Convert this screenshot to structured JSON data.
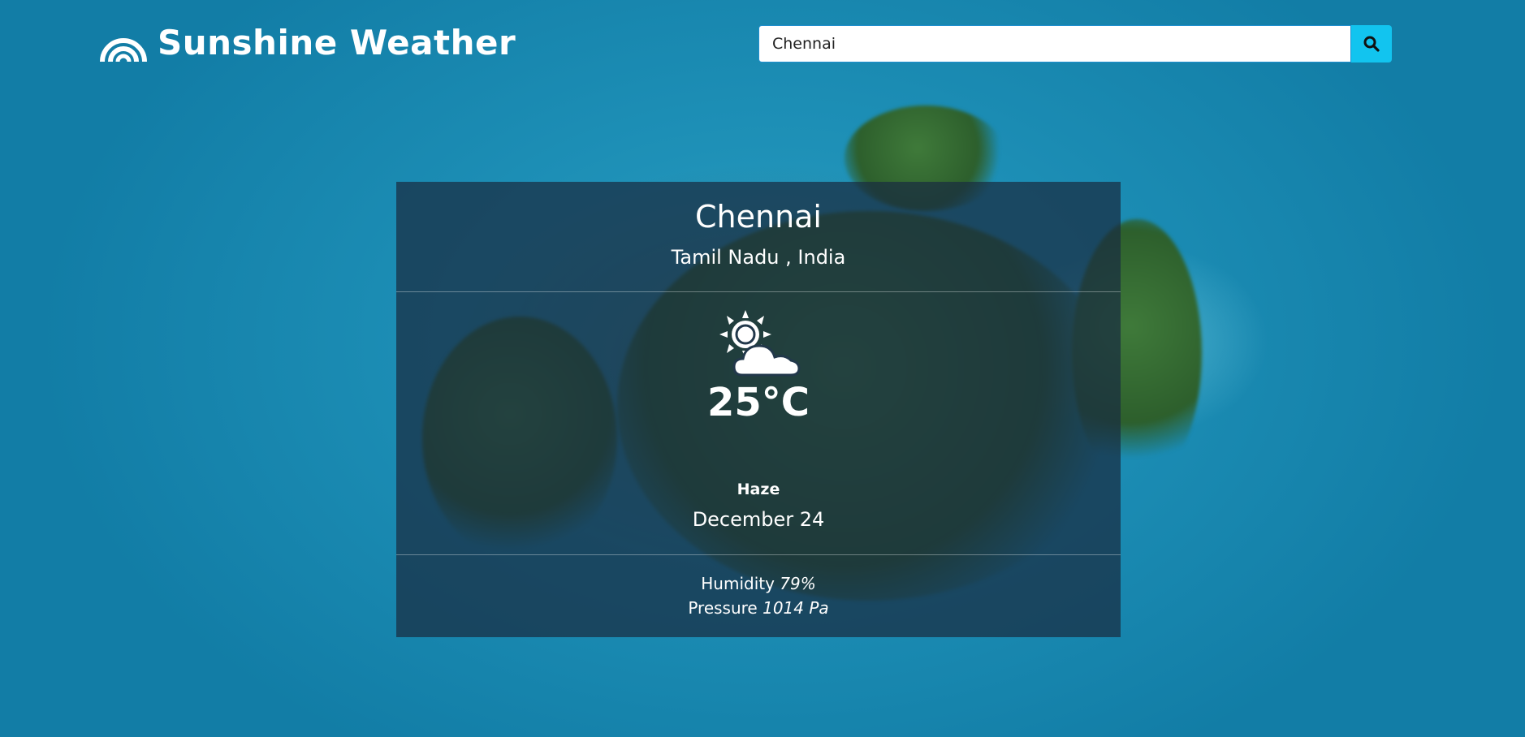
{
  "app": {
    "title": "Sunshine Weather",
    "logo_icon": "rainbow-icon"
  },
  "search": {
    "value": "Chennai",
    "placeholder": "",
    "button_icon": "search-icon",
    "button_color": "#12c4ef"
  },
  "weather": {
    "city": "Chennai",
    "region": "Tamil Nadu , India",
    "icon": "partly-cloudy-day-icon",
    "temperature": "25",
    "temperature_unit": "°C",
    "condition": "Haze",
    "date": "December 24",
    "humidity_label": "Humidity",
    "humidity_value": "79%",
    "pressure_label": "Pressure",
    "pressure_value": "1014 Pa"
  }
}
